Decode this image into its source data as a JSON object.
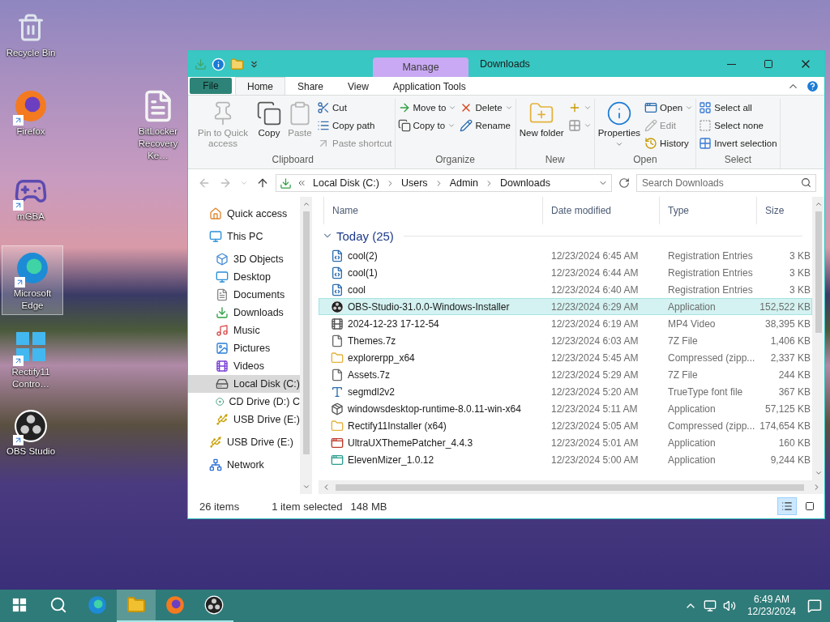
{
  "desktop": {
    "icons": [
      {
        "label": "Recycle Bin",
        "selected": false
      },
      {
        "label": "Firefox",
        "selected": false
      },
      {
        "label": "BitLocker Recovery Ke…",
        "selected": false
      },
      {
        "label": "mGBA",
        "selected": false
      },
      {
        "label": "Microsoft Edge",
        "selected": true
      },
      {
        "label": "Rectify11 Contro…",
        "selected": false
      },
      {
        "label": "OBS Studio",
        "selected": false
      }
    ]
  },
  "window": {
    "title": "Downloads",
    "context_tab": "Manage",
    "file_tab": "File",
    "ribbon_tabs": [
      {
        "label": "Home",
        "selected": true
      },
      {
        "label": "Share",
        "selected": false
      },
      {
        "label": "View",
        "selected": false
      },
      {
        "label": "Application Tools",
        "selected": false
      }
    ],
    "ribbon_groups": [
      {
        "title": "Clipboard",
        "columns": [
          [
            {
              "label": "Pin to Quick access",
              "kind": "large",
              "disabled": true
            }
          ],
          [
            {
              "label": "Copy",
              "kind": "large",
              "disabled": false
            }
          ],
          [
            {
              "label": "Paste",
              "kind": "large",
              "disabled": true
            }
          ],
          [
            {
              "label": "Cut",
              "kind": "small",
              "disabled": false
            },
            {
              "label": "Copy path",
              "kind": "small",
              "disabled": false
            },
            {
              "label": "Paste shortcut",
              "kind": "small",
              "disabled": true
            }
          ]
        ]
      },
      {
        "title": "Organize",
        "columns": [
          [
            {
              "label": "Move to",
              "kind": "small",
              "disabled": false
            },
            {
              "label": "Copy to",
              "kind": "small",
              "disabled": false
            }
          ],
          [
            {
              "label": "Delete",
              "kind": "small",
              "disabled": false
            },
            {
              "label": "Rename",
              "kind": "small",
              "disabled": false
            }
          ]
        ]
      },
      {
        "title": "New",
        "columns": [
          [
            {
              "label": "New folder",
              "kind": "large",
              "disabled": false
            }
          ],
          [
            {
              "kind": "small",
              "disabled": false
            },
            {
              "kind": "small",
              "disabled": false
            }
          ]
        ]
      },
      {
        "title": "Open",
        "columns": [
          [
            {
              "label": "Properties",
              "kind": "large",
              "disabled": false
            }
          ],
          [
            {
              "label": "Open",
              "kind": "small",
              "disabled": false
            },
            {
              "label": "Edit",
              "kind": "small",
              "disabled": true
            },
            {
              "label": "History",
              "kind": "small",
              "disabled": false
            }
          ]
        ]
      },
      {
        "title": "Select",
        "columns": [
          [
            {
              "label": "Select all",
              "kind": "small",
              "disabled": false
            },
            {
              "label": "Select none",
              "kind": "small",
              "disabled": false
            },
            {
              "label": "Invert selection",
              "kind": "small",
              "disabled": false
            }
          ]
        ]
      }
    ],
    "address": {
      "path": [
        "Local Disk (C:)",
        "Users",
        "Admin",
        "Downloads"
      ]
    },
    "search": {
      "placeholder": "Search Downloads"
    },
    "nav": [
      {
        "label": "Quick access",
        "selected": false
      },
      {
        "label": "This PC",
        "selected": false,
        "children": [
          {
            "label": "3D Objects",
            "selected": false
          },
          {
            "label": "Desktop",
            "selected": false
          },
          {
            "label": "Documents",
            "selected": false
          },
          {
            "label": "Downloads",
            "selected": false
          },
          {
            "label": "Music",
            "selected": false
          },
          {
            "label": "Pictures",
            "selected": false
          },
          {
            "label": "Videos",
            "selected": false
          },
          {
            "label": "Local Disk (C:)",
            "selected": true
          },
          {
            "label": "CD Drive (D:) C",
            "selected": false
          },
          {
            "label": "USB Drive (E:)",
            "selected": false
          }
        ]
      },
      {
        "label": "USB Drive (E:)",
        "selected": false
      },
      {
        "label": "Network",
        "selected": false
      }
    ],
    "files": {
      "columns": [
        "Name",
        "Date modified",
        "Type",
        "Size"
      ],
      "group": {
        "label": "Today (25)",
        "expanded": true
      },
      "rows": [
        {
          "name": "cool(2)",
          "date": "12/23/2024 6:45 AM",
          "type": "Registration Entries",
          "size": "3 KB",
          "selected": false
        },
        {
          "name": "cool(1)",
          "date": "12/23/2024 6:44 AM",
          "type": "Registration Entries",
          "size": "3 KB",
          "selected": false
        },
        {
          "name": "cool",
          "date": "12/23/2024 6:40 AM",
          "type": "Registration Entries",
          "size": "3 KB",
          "selected": false
        },
        {
          "name": "OBS-Studio-31.0.0-Windows-Installer",
          "date": "12/23/2024 6:29 AM",
          "type": "Application",
          "size": "152,522 KB",
          "selected": true
        },
        {
          "name": "2024-12-23 17-12-54",
          "date": "12/23/2024 6:19 AM",
          "type": "MP4 Video",
          "size": "38,395 KB",
          "selected": false
        },
        {
          "name": "Themes.7z",
          "date": "12/23/2024 6:03 AM",
          "type": "7Z File",
          "size": "1,406 KB",
          "selected": false
        },
        {
          "name": "explorerpp_x64",
          "date": "12/23/2024 5:45 AM",
          "type": "Compressed (zipp...",
          "size": "2,337 KB",
          "selected": false
        },
        {
          "name": "Assets.7z",
          "date": "12/23/2024 5:29 AM",
          "type": "7Z File",
          "size": "244 KB",
          "selected": false
        },
        {
          "name": "segmdl2v2",
          "date": "12/23/2024 5:20 AM",
          "type": "TrueType font file",
          "size": "367 KB",
          "selected": false
        },
        {
          "name": "windowsdesktop-runtime-8.0.11-win-x64",
          "date": "12/23/2024 5:11 AM",
          "type": "Application",
          "size": "57,125 KB",
          "selected": false
        },
        {
          "name": "Rectify11Installer (x64)",
          "date": "12/23/2024 5:05 AM",
          "type": "Compressed (zipp...",
          "size": "174,654 KB",
          "selected": false
        },
        {
          "name": "UltraUXThemePatcher_4.4.3",
          "date": "12/23/2024 5:01 AM",
          "type": "Application",
          "size": "160 KB",
          "selected": false
        },
        {
          "name": "ElevenMizer_1.0.12",
          "date": "12/23/2024 5:00 AM",
          "type": "Application",
          "size": "9,244 KB",
          "selected": false
        }
      ]
    },
    "status_bar": {
      "count": "26 items",
      "selection": "1 item selected",
      "size": "148 MB",
      "views": [
        {
          "selected": true
        },
        {
          "selected": false
        }
      ]
    }
  },
  "taskbar": {
    "apps": [
      {
        "active": false,
        "running": false
      },
      {
        "active": true,
        "running": true
      },
      {
        "active": false,
        "running": true
      },
      {
        "active": false,
        "running": true
      }
    ],
    "clock": {
      "time": "6:49 AM",
      "date": "12/23/2024"
    }
  }
}
